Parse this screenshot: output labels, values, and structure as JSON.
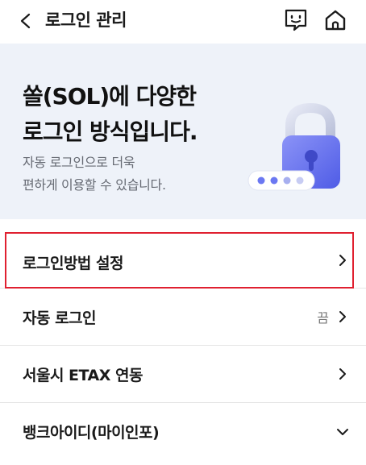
{
  "header": {
    "title": "로그인 관리",
    "icons": {
      "back": "chevron-left-icon",
      "chat": "chat-bubble-icon",
      "home": "home-icon"
    }
  },
  "hero": {
    "title_line1": "쏠(SOL)에 다양한",
    "title_line2": "로그인 방식입니다.",
    "subtitle_line1": "자동 로그인으로 더욱",
    "subtitle_line2": "편하게 이용할 수 있습니다.",
    "illustration": "padlock-password-icon"
  },
  "menu": {
    "items": [
      {
        "label": "로그인방법 설정",
        "value": "",
        "chevron": "chevron-right-icon"
      },
      {
        "label": "자동 로그인",
        "value": "끔",
        "chevron": "chevron-right-icon"
      },
      {
        "label": "서울시 ETAX 연동",
        "value": "",
        "chevron": "chevron-right-icon"
      },
      {
        "label": "뱅크아이디(마이인포)",
        "value": "",
        "chevron": "chevron-down-icon"
      }
    ]
  },
  "colors": {
    "hero_bg": "#eef2f9",
    "accent": "#6b78f2",
    "highlight": "#e02030"
  }
}
